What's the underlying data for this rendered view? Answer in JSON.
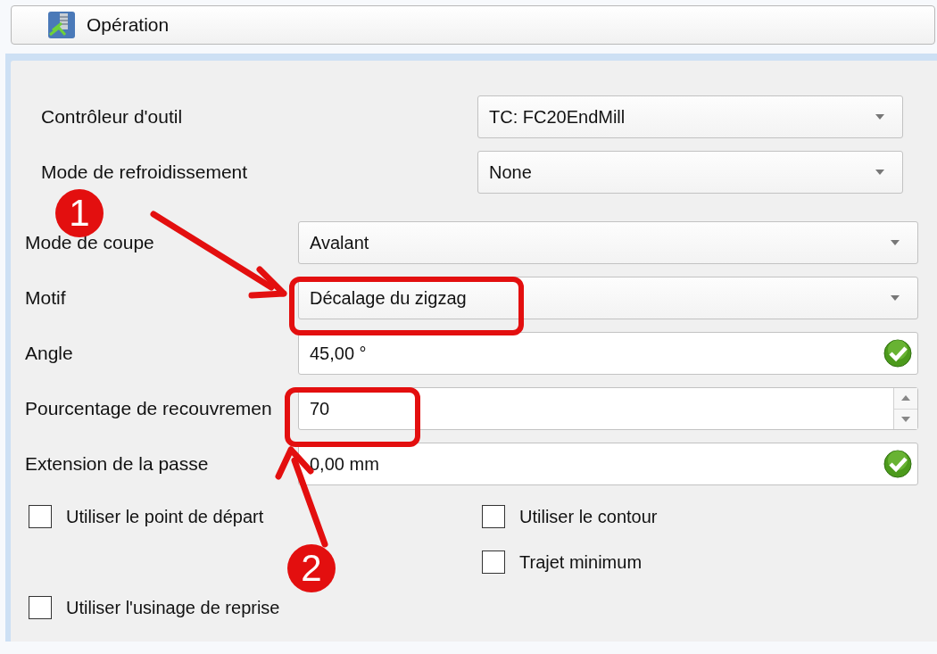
{
  "header": {
    "title": "Opération"
  },
  "top_rows": [
    {
      "label": "Contrôleur d'outil",
      "kind": "combo",
      "value": "TC: FC20EndMill"
    },
    {
      "label": "Mode de refroidissement",
      "kind": "combo",
      "value": "None"
    }
  ],
  "rows": [
    {
      "label": "Mode de coupe",
      "kind": "combo",
      "value": "Avalant"
    },
    {
      "label": "Motif",
      "kind": "combo",
      "value": "Décalage du zigzag"
    },
    {
      "label": "Angle",
      "kind": "quantity",
      "value": "45,00 °",
      "valid": true
    },
    {
      "label": "Pourcentage de recouvremen",
      "kind": "spin",
      "value": "70"
    },
    {
      "label": "Extension de la passe",
      "kind": "quantity",
      "value": "0,00 mm",
      "valid": true
    }
  ],
  "checkboxes": {
    "column_1": [
      {
        "label": "Utiliser le point de départ",
        "checked": false
      },
      {
        "label": "Utiliser l'usinage de reprise",
        "checked": false
      }
    ],
    "column_2": [
      {
        "label": "Utiliser le contour",
        "checked": false
      },
      {
        "label": "Trajet minimum",
        "checked": false
      }
    ]
  },
  "annotations": [
    {
      "label": "1"
    },
    {
      "label": "2"
    }
  ]
}
